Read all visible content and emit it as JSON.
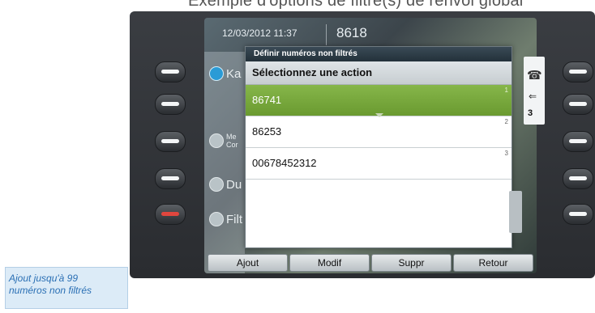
{
  "caption": {
    "top_text": "Exemple d'options de filtre(s) de renvoi global"
  },
  "header": {
    "datetime": "12/03/2012 11:37",
    "extension": "8618"
  },
  "lines": [
    {
      "label": "Ka",
      "icon": "handset-icon"
    },
    {
      "label": "Me\nCor",
      "icon": "speaker-icon"
    },
    {
      "label": "Du",
      "icon": "handset-icon"
    },
    {
      "label": "Filt",
      "icon": "filter-icon"
    }
  ],
  "popup": {
    "title": "Définir numéros non filtrés",
    "subtitle": "Sélectionnez une action",
    "items": [
      {
        "number": "86741",
        "index": "1"
      },
      {
        "number": "86253",
        "index": "2"
      },
      {
        "number": "00678452312",
        "index": "3"
      }
    ]
  },
  "right_panel": {
    "badge": "3",
    "handset_icon": "handset-icon",
    "arrow_icon": "arrow-left-icon"
  },
  "softkeys": {
    "add": "Ajout",
    "edit": "Modif",
    "delete": "Suppr",
    "back": "Retour"
  },
  "callout": {
    "line1": "Ajout jusqu'à 99",
    "line2": "numéros non filtrés"
  },
  "colors": {
    "selected_row": "#7aa83d",
    "popup_title_bg": "#2d3b45",
    "callout_text": "#2a6fb4"
  }
}
